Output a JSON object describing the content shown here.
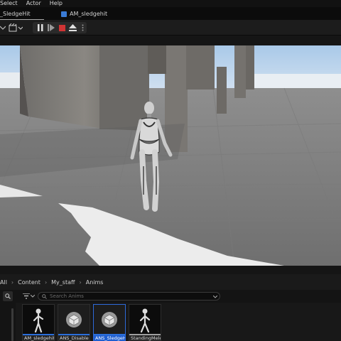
{
  "menu": {
    "items": [
      "Select",
      "Actor",
      "Help"
    ]
  },
  "tabs": [
    {
      "label": "_SledgeHit"
    },
    {
      "label": "AM_sledgehit"
    }
  ],
  "toolbar": {
    "pause_icon": "pause-icon",
    "step_icon": "skip-frame-icon",
    "stop_icon": "stop-icon",
    "eject_icon": "eject-icon"
  },
  "content_browser": {
    "breadcrumb": [
      "All",
      "Content",
      "My_staff",
      "Anims"
    ],
    "search_placeholder": "Search Anims",
    "assets": [
      {
        "label": "AM_sledgehit",
        "type": "animation",
        "selected": false
      },
      {
        "label": "ANS_Disable",
        "type": "notify",
        "selected": false
      },
      {
        "label": "ANS_SledgeHit",
        "type": "notify",
        "selected": true
      },
      {
        "label": "StandingMelee",
        "type": "animation",
        "selected": false
      }
    ]
  },
  "colors": {
    "accent": "#2b6fdb",
    "stop": "#d03434",
    "background": "#151515"
  }
}
